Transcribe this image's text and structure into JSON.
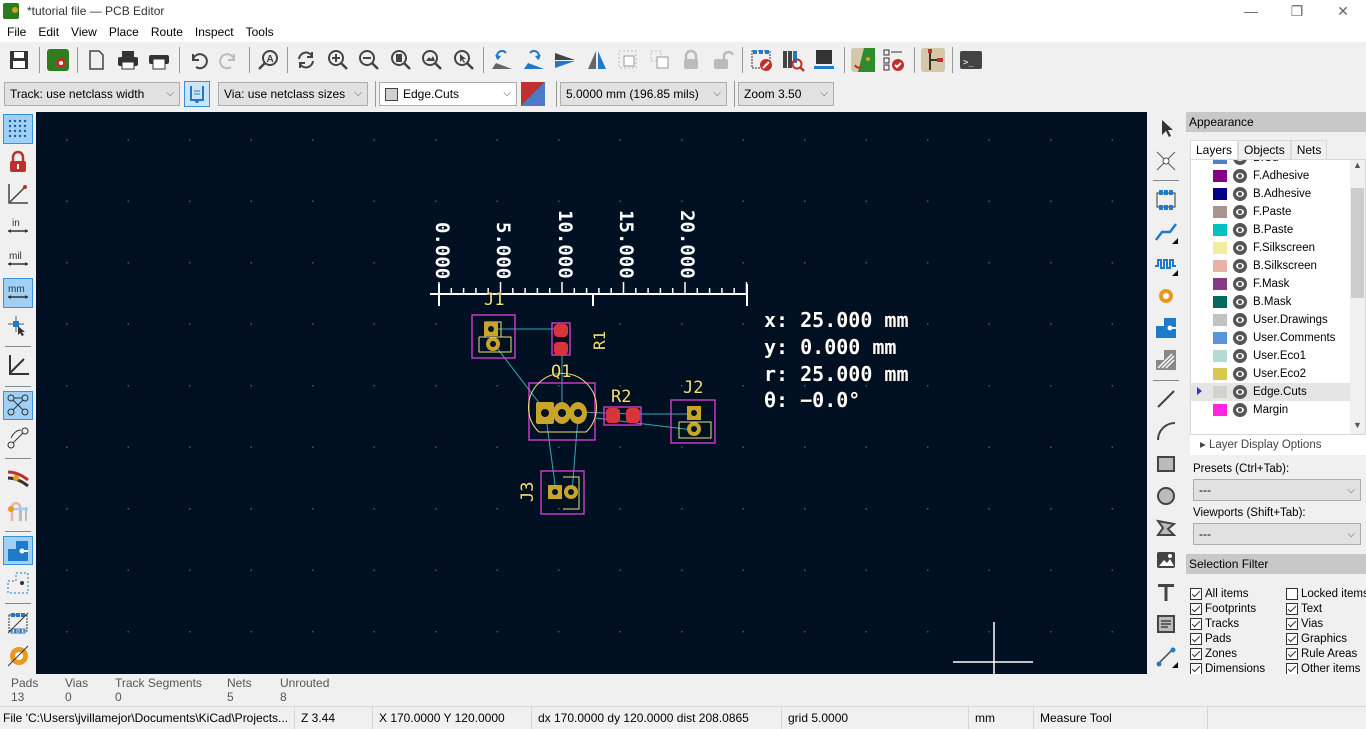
{
  "window": {
    "title": "*tutorial file — PCB Editor",
    "minimize": "—",
    "restore": "❐",
    "close": "✕"
  },
  "menu": [
    "File",
    "Edit",
    "View",
    "Place",
    "Route",
    "Inspect",
    "Tools"
  ],
  "toolbar2": {
    "track_width": "Track: use netclass width",
    "via_size": "Via: use netclass sizes",
    "layer": "Edge.Cuts",
    "layer_color": "#d0d0d0",
    "grid": "5.0000 mm (196.85 mils)",
    "zoom": "Zoom 3.50"
  },
  "canvas": {
    "ruler_labels": [
      "0.000",
      "5.000",
      "10.000",
      "15.000",
      "20.000"
    ],
    "measure_readout": {
      "x": "x: 25.000  mm",
      "y": "y: 0.000  mm",
      "r": "r: 25.000  mm",
      "theta": "θ: −0.0°"
    },
    "footprints": {
      "j1": "J1",
      "j2": "J2",
      "j3": "J3",
      "q1": "Q1",
      "r1": "R1",
      "r2": "R2"
    }
  },
  "appearance": {
    "title": "Appearance",
    "tabs": [
      "Layers",
      "Objects",
      "Nets"
    ],
    "layers": [
      {
        "name": "B.Cu",
        "color": "#4d7fc4"
      },
      {
        "name": "F.Adhesive",
        "color": "#840084"
      },
      {
        "name": "B.Adhesive",
        "color": "#000084"
      },
      {
        "name": "F.Paste",
        "color": "#a8968e"
      },
      {
        "name": "B.Paste",
        "color": "#00c2c2"
      },
      {
        "name": "F.Silkscreen",
        "color": "#f2eda1"
      },
      {
        "name": "B.Silkscreen",
        "color": "#e8b2a7"
      },
      {
        "name": "F.Mask",
        "color": "#843b84"
      },
      {
        "name": "B.Mask",
        "color": "#026a5e"
      },
      {
        "name": "User.Drawings",
        "color": "#c2c2c2"
      },
      {
        "name": "User.Comments",
        "color": "#5994dc"
      },
      {
        "name": "User.Eco1",
        "color": "#b4dbd2"
      },
      {
        "name": "User.Eco2",
        "color": "#d8c852"
      },
      {
        "name": "Edge.Cuts",
        "color": "#d0d2cd"
      },
      {
        "name": "Margin",
        "color": "#ff26e2"
      }
    ],
    "active_layer": "Edge.Cuts",
    "layer_display_options": "Layer Display Options",
    "presets_label": "Presets (Ctrl+Tab):",
    "presets_value": "---",
    "viewports_label": "Viewports (Shift+Tab):",
    "viewports_value": "---"
  },
  "selection_filter": {
    "title": "Selection Filter",
    "items": [
      {
        "label": "All items",
        "checked": true
      },
      {
        "label": "Locked items",
        "checked": false
      },
      {
        "label": "Footprints",
        "checked": true
      },
      {
        "label": "Text",
        "checked": true
      },
      {
        "label": "Tracks",
        "checked": true
      },
      {
        "label": "Vias",
        "checked": true
      },
      {
        "label": "Pads",
        "checked": true
      },
      {
        "label": "Graphics",
        "checked": true
      },
      {
        "label": "Zones",
        "checked": true
      },
      {
        "label": "Rule Areas",
        "checked": true
      },
      {
        "label": "Dimensions",
        "checked": true
      },
      {
        "label": "Other items",
        "checked": true
      }
    ]
  },
  "stats": [
    {
      "label": "Pads",
      "value": "13"
    },
    {
      "label": "Vias",
      "value": "0"
    },
    {
      "label": "Track Segments",
      "value": "0"
    },
    {
      "label": "Nets",
      "value": "5"
    },
    {
      "label": "Unrouted",
      "value": "8"
    }
  ],
  "status": {
    "file": "File 'C:\\Users\\jvillamejor\\Documents\\KiCad\\Projects...",
    "zoom": "Z 3.44",
    "coords": "X 170.0000  Y 120.0000",
    "delta": "dx 170.0000  dy 120.0000  dist 208.0865",
    "grid": "grid 5.0000",
    "units": "mm",
    "tool": "Measure Tool"
  }
}
